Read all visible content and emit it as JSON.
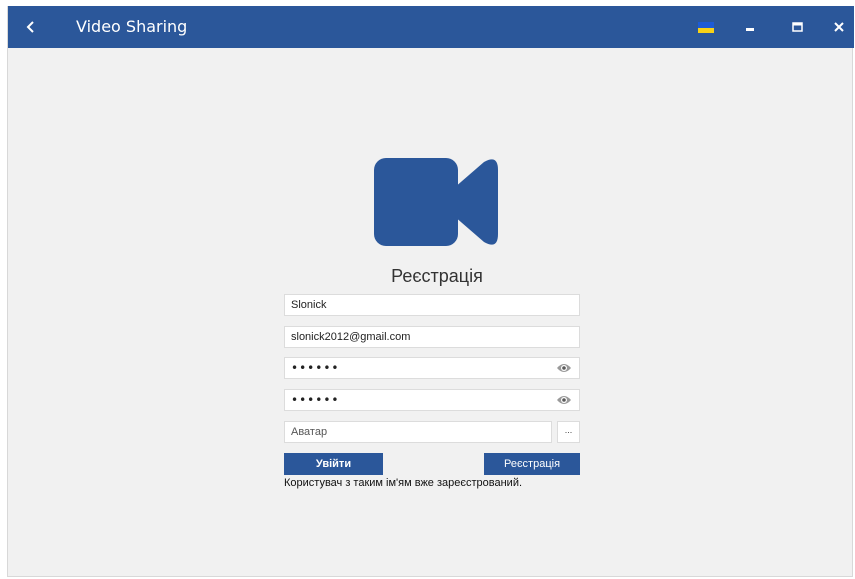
{
  "window": {
    "title": "Video Sharing"
  },
  "titlebar_icons": {
    "back": "chevron-left-icon",
    "flag": "ukraine-flag-icon",
    "minimize": "minimize-icon",
    "maximize": "maximize-icon",
    "close": "close-icon"
  },
  "colors": {
    "accent": "#2b579a",
    "background": "#f1f1f1",
    "flag_blue": "#1d5bd6",
    "flag_yellow": "#f7d117"
  },
  "logo": {
    "icon": "video-camera-icon"
  },
  "form": {
    "title": "Реєстрація",
    "username": "Slonick",
    "email": "slonick2012@gmail.com",
    "password": "••••••",
    "password_confirm": "••••••",
    "avatar_placeholder": "Аватар",
    "browse_label": "...",
    "login_button": "Увійти",
    "register_button": "Реєстрація",
    "error_message": "Користувач з таким ім'ям вже зареєстрований."
  }
}
